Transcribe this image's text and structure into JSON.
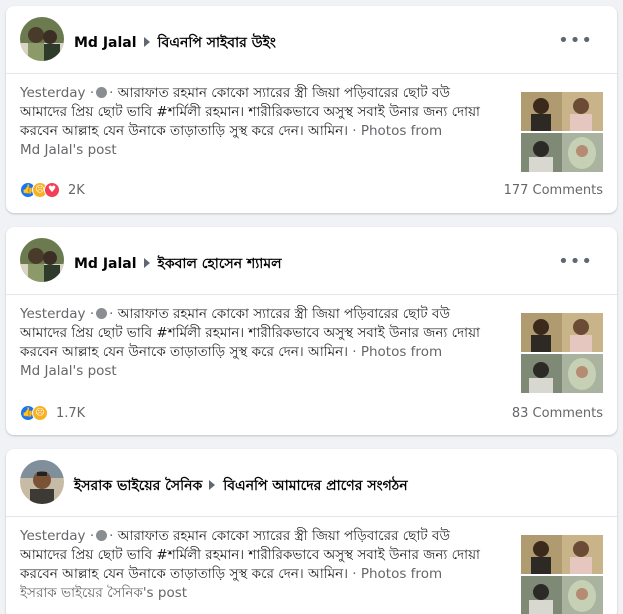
{
  "colors": {
    "like": "#1877f2",
    "sad": "#f7b125",
    "love": "#f33e58",
    "meta": "#65676b"
  },
  "posts": [
    {
      "author": "Md Jalal",
      "group": "বিএনপি সাইবার উইং",
      "meta": "Yesterday ·",
      "text": "আরাফাত রহমান কোকো স্যারের স্ত্রী জিয়া পড়িবারের ছোট বউ আমাদের প্রিয় ছোট ভাবি #শর্মিলী রহমান। শারীরিকভাবে অসুস্থ সবাই উনার জন্য দোয়া করবেন আল্লাহ যেন উনাকে তাড়াতাড়ি সুস্থ করে দেন। আমিন।",
      "photos_from": "· Photos from",
      "source": "Md Jalal's post",
      "reactions_count": "2K",
      "comments": "177 Comments",
      "reaction_icons": [
        "like-icon",
        "sad-icon",
        "love-icon"
      ]
    },
    {
      "author": "Md Jalal",
      "group": "ইকবাল হোসেন শ্যামল",
      "meta": "Yesterday ·",
      "text": "আরাফাত রহমান কোকো স্যারের স্ত্রী জিয়া পড়িবারের ছোট বউ আমাদের প্রিয় ছোট ভাবি #শর্মিলী রহমান। শারীরিকভাবে অসুস্থ সবাই উনার জন্য দোয়া করবেন আল্লাহ যেন উনাকে তাড়াতাড়ি সুস্থ করে দেন। আমিন।",
      "photos_from": "· Photos from",
      "source": "Md Jalal's post",
      "reactions_count": "1.7K",
      "comments": "83 Comments",
      "reaction_icons": [
        "like-icon",
        "sad-icon",
        "love-icon"
      ]
    },
    {
      "author": "ইসরাক ভাইয়ের সৈনিক",
      "group": "বিএনপি আমাদের প্রাণের সংগঠন",
      "meta": "Yesterday ·",
      "text": "আরাফাত রহমান কোকো স্যারের স্ত্রী জিয়া পড়িবারের ছোট বউ আমাদের প্রিয় ছোট ভাবি #শর্মিলী রহমান। শারীরিকভাবে অসুস্থ সবাই উনার জন্য দোয়া করবেন আল্লাহ যেন উনাকে তাড়াতাড়ি সুস্থ করে দেন। আমিন।",
      "photos_from": "· Photos from",
      "source": "ইসরাক ভাইয়ের সৈনিক's post"
    }
  ]
}
